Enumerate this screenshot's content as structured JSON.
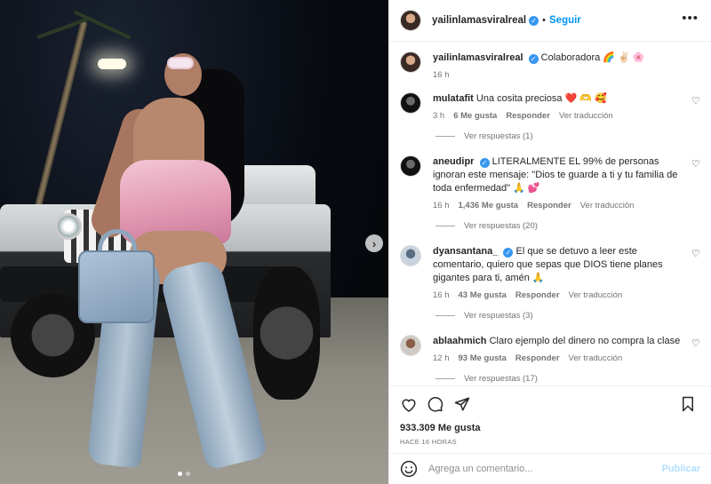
{
  "post": {
    "author": "yailinlamasviralreal",
    "separator": "•",
    "follow_label": "Seguir",
    "more_label": "•••"
  },
  "caption": {
    "username": "yailinlamasviralreal",
    "text": "Colaboradora 🌈 ✌🏻 🌸",
    "age": "16 h"
  },
  "comments": [
    {
      "username": "mulatafit",
      "text": "Una cosita preciosa ❤️ 🫶 🥰",
      "age": "3 h",
      "likes": "6 Me gusta",
      "reply_label": "Responder",
      "translate_label": "Ver traducción",
      "replies_label": "Ver respuestas (1)",
      "avatar_style": "dark",
      "verified": false
    },
    {
      "username": "aneudipr",
      "text": "LITERALMENTE EL 99% de personas ignoran este mensaje: \"Dios te guarde a ti y tu familia de toda enfermedad\" 🙏 💕",
      "age": "16 h",
      "likes": "1,436 Me gusta",
      "reply_label": "Responder",
      "translate_label": "Ver traducción",
      "replies_label": "Ver respuestas (20)",
      "avatar_style": "dark",
      "verified": true
    },
    {
      "username": "dyansantana_",
      "text": "El que se detuvo a leer este comentario, quiero que sepas que DIOS tiene planes gigantes para ti, amén 🙏",
      "age": "16 h",
      "likes": "43 Me gusta",
      "reply_label": "Responder",
      "translate_label": "Ver traducción",
      "replies_label": "Ver respuestas (3)",
      "avatar_style": "blue",
      "verified": true
    },
    {
      "username": "ablaahmich",
      "text": "Claro ejemplo del dinero no compra la clase",
      "age": "12 h",
      "likes": "93 Me gusta",
      "reply_label": "Responder",
      "translate_label": "Ver traducción",
      "replies_label": "Ver respuestas (17)",
      "avatar_style": "brown",
      "verified": false
    }
  ],
  "actions": {
    "likes": "933.309 Me gusta",
    "time": "HACE 16 HORAS",
    "icons": [
      "heart-icon",
      "comment-icon",
      "share-icon",
      "save-icon"
    ]
  },
  "composer": {
    "placeholder": "Agrega un comentario...",
    "publish_label": "Publicar"
  },
  "colors": {
    "accent": "#0095f6",
    "verified": "#3897f0",
    "publish_disabled": "#b2dffc",
    "muted_text": "#737373"
  }
}
